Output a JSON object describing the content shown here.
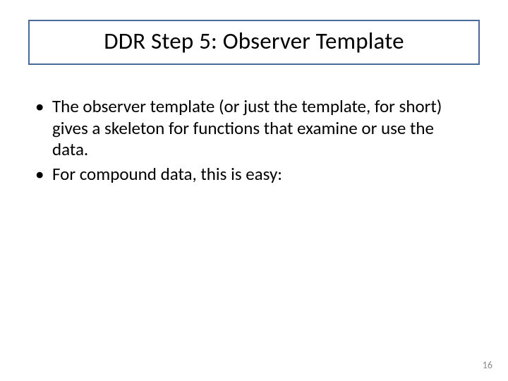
{
  "slide": {
    "title": "DDR Step 5: Observer Template",
    "bullets": [
      "The observer template (or just the template, for short) gives a skeleton for functions that examine or use the data.",
      "For compound data, this is easy:"
    ],
    "page_number": "16"
  }
}
